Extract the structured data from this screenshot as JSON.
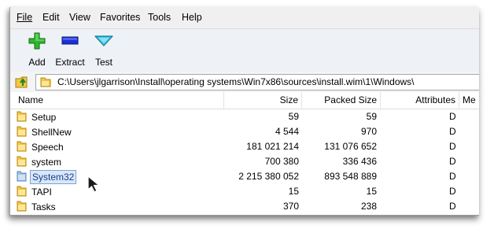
{
  "menu": {
    "file": "File",
    "edit": "Edit",
    "view": "View",
    "favorites": "Favorites",
    "tools": "Tools",
    "help": "Help"
  },
  "toolbar": {
    "add_label": "Add",
    "extract_label": "Extract",
    "test_label": "Test"
  },
  "address": {
    "path": "C:\\Users\\jlgarrison\\Install\\operating systems\\Win7x86\\sources\\install.wim\\1\\Windows\\"
  },
  "columns": {
    "name": "Name",
    "size": "Size",
    "packed": "Packed Size",
    "attributes": "Attributes",
    "more": "Me"
  },
  "files": [
    {
      "name": "Setup",
      "size": "59",
      "packed": "59",
      "attributes": "D"
    },
    {
      "name": "ShellNew",
      "size": "4 544",
      "packed": "970",
      "attributes": "D"
    },
    {
      "name": "Speech",
      "size": "181 021 214",
      "packed": "131 076 652",
      "attributes": "D"
    },
    {
      "name": "system",
      "size": "700 380",
      "packed": "336 436",
      "attributes": "D"
    },
    {
      "name": "System32",
      "size": "2 215 380 052",
      "packed": "893 548 889",
      "attributes": "D",
      "selected": true
    },
    {
      "name": "TAPI",
      "size": "15",
      "packed": "15",
      "attributes": "D"
    },
    {
      "name": "Tasks",
      "size": "370",
      "packed": "238",
      "attributes": "D"
    }
  ],
  "colors": {
    "add_green": "#2eb82e",
    "extract_blue": "#1a2fd6",
    "test_cyan": "#3cc8e8",
    "folder_yellow": "#f5c842",
    "selection_bg": "#d8e7fa"
  },
  "icons": {
    "add": "plus-icon",
    "extract": "minus-icon",
    "test": "check-icon",
    "up": "up-folder-icon",
    "folder": "folder-icon"
  }
}
